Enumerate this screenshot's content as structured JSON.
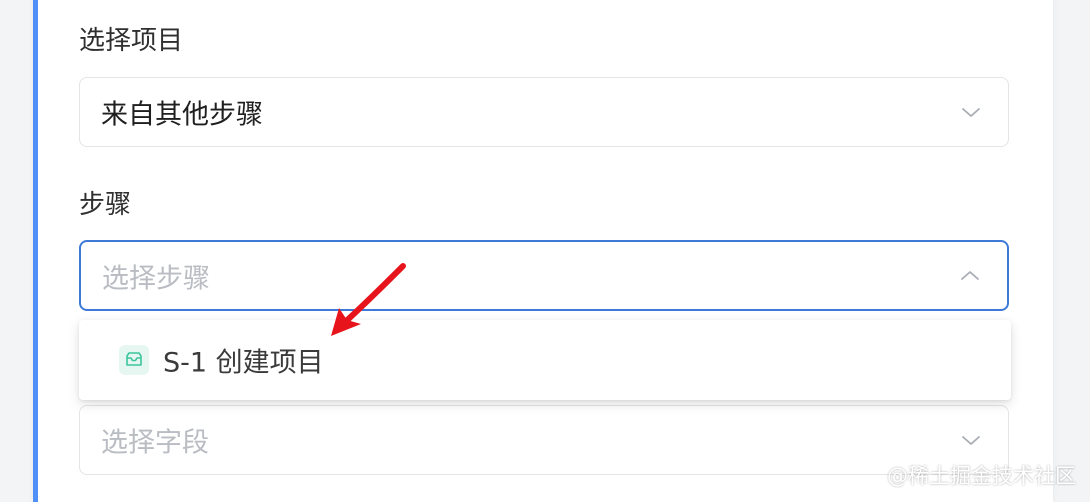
{
  "form": {
    "project_label": "选择项目",
    "project_select": {
      "value": "来自其他步骤"
    },
    "step_label": "步骤",
    "step_select": {
      "placeholder": "选择步骤"
    },
    "dropdown": {
      "options": [
        {
          "label": "S-1 创建项目",
          "icon": "inbox-icon"
        }
      ]
    },
    "field_select": {
      "placeholder": "选择字段"
    }
  },
  "colors": {
    "accent": "#4f8ff7",
    "focus_border": "#3d7ad8",
    "annotation_arrow": "#e8141b",
    "option_icon": "#3cc59b"
  },
  "watermark": "@稀土掘金技术社区"
}
